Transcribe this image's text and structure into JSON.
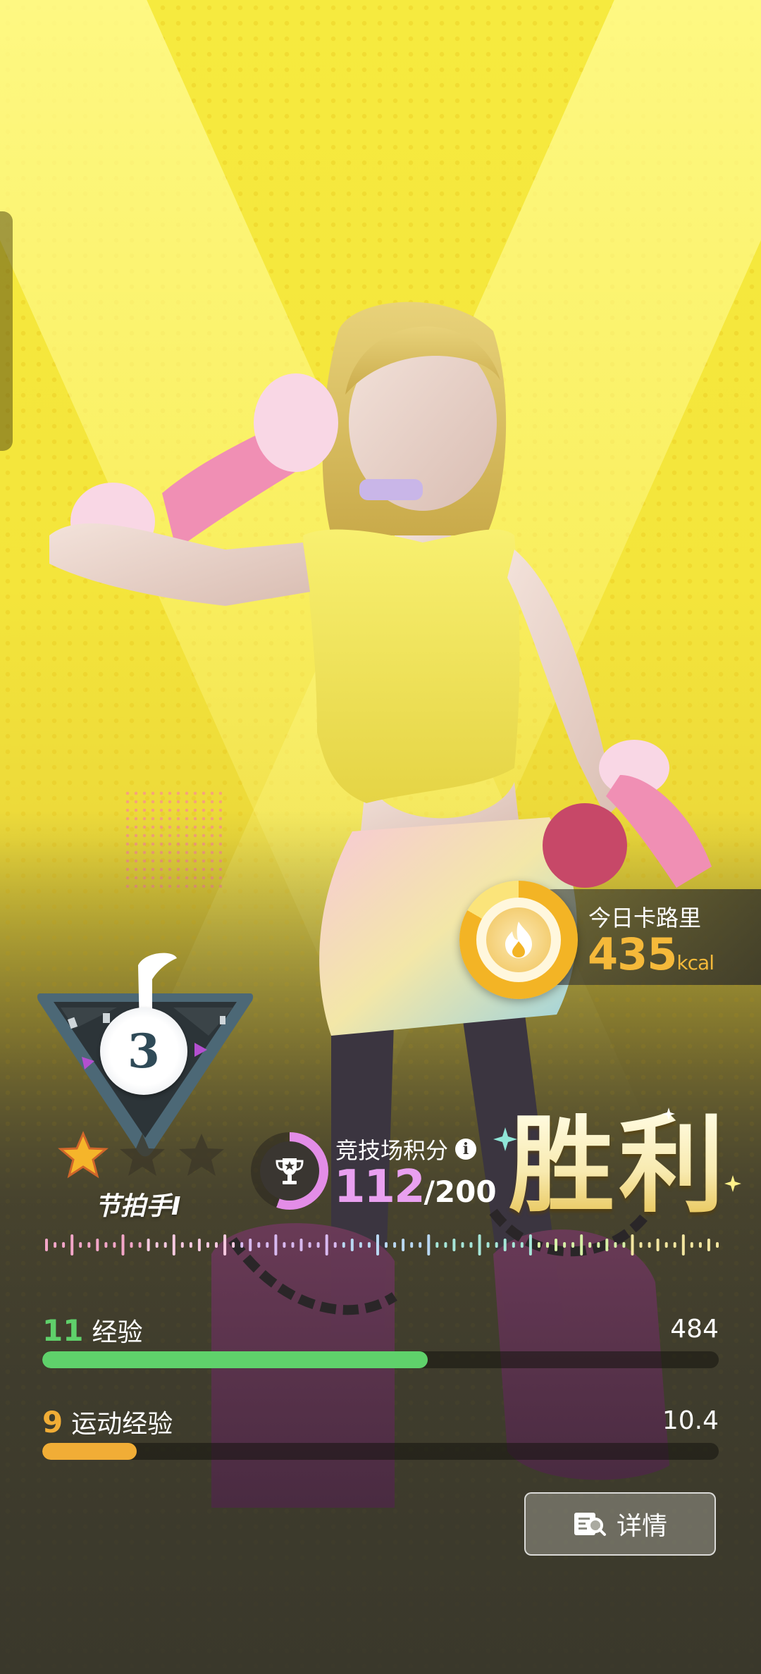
{
  "calories": {
    "title": "今日卡路里",
    "value": "435",
    "unit": "kcal",
    "ring_color": "#f3b425"
  },
  "rank": {
    "level": "3",
    "title": "节拍手I",
    "stars_filled": 1,
    "stars_total": 3
  },
  "arena": {
    "label": "竞技场积分",
    "score": "112",
    "max": "/200",
    "info_icon": "info-icon",
    "trophy_icon": "trophy-icon",
    "accent": "#e9a0f0"
  },
  "result": {
    "text": "胜利"
  },
  "experience": {
    "level": "11",
    "label": "经验",
    "value": "484",
    "progress": 0.57,
    "color": "#5fd16b"
  },
  "sport_experience": {
    "level": "9",
    "label": "运动经验",
    "value": "10.4",
    "progress": 0.14,
    "color": "#f1ad36"
  },
  "detail_button": {
    "label": "详情",
    "icon": "detail-search-icon"
  }
}
